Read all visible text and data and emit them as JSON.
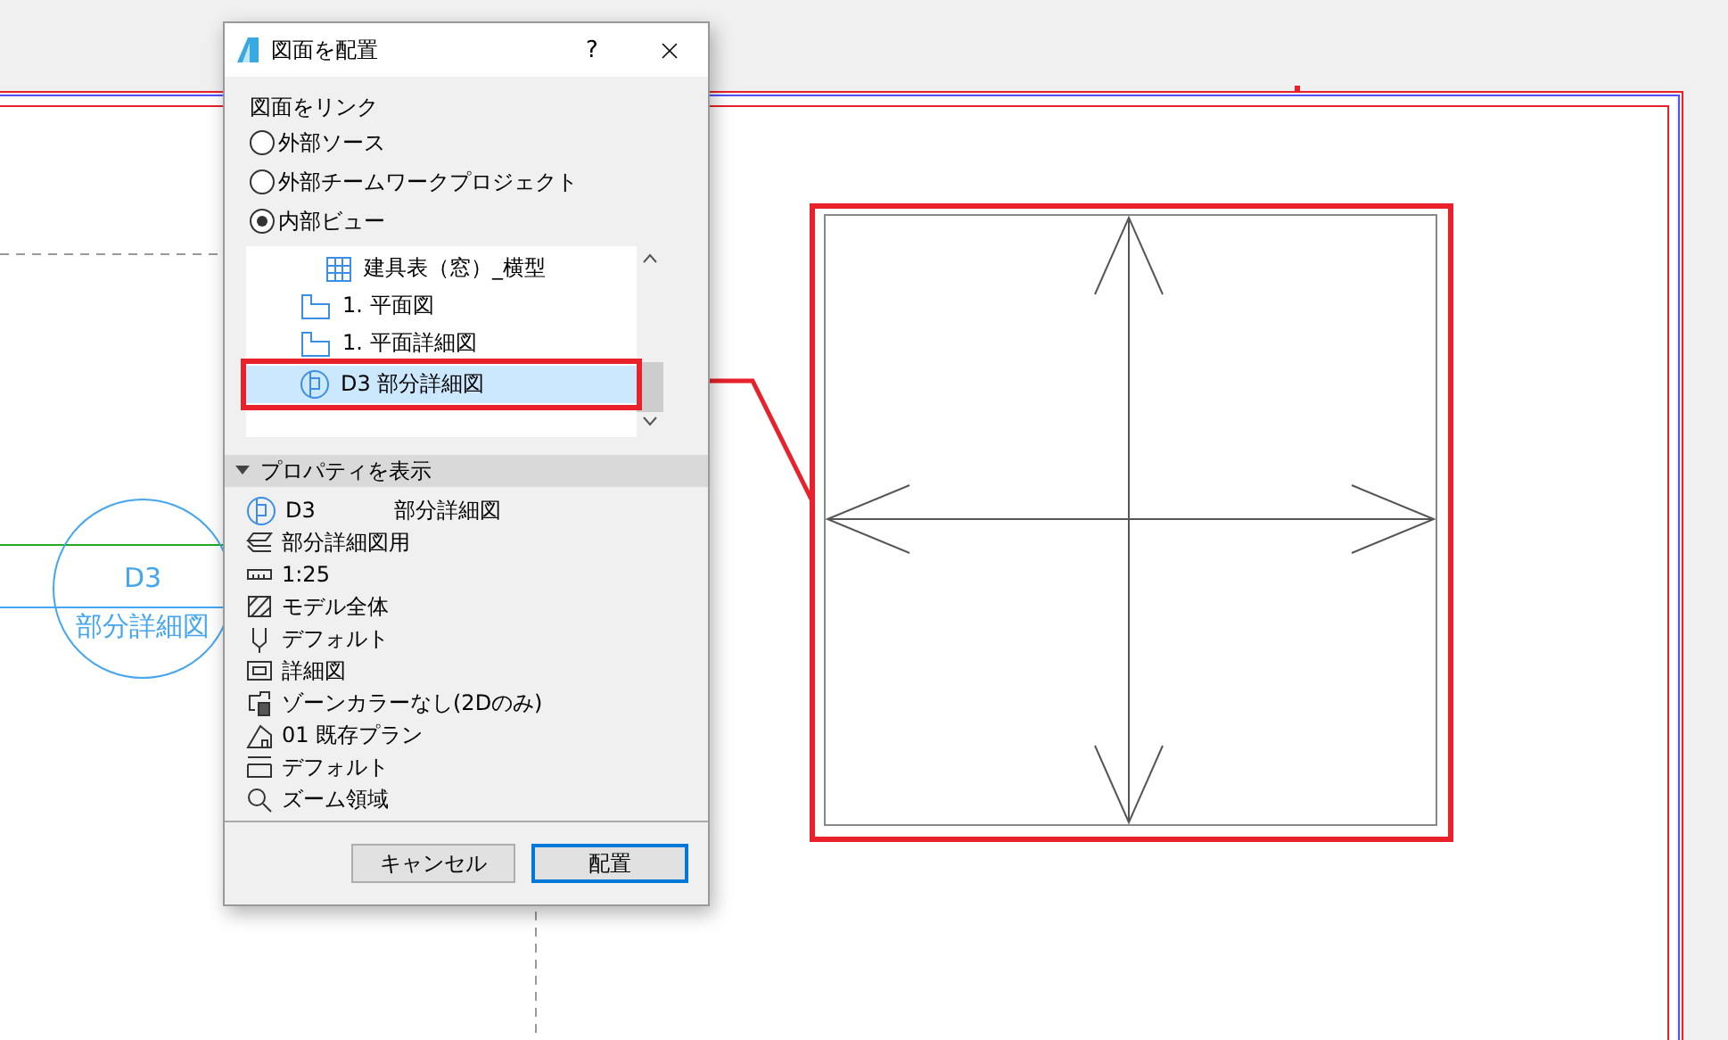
{
  "dialog": {
    "title": "図面を配置",
    "help": "?",
    "link_label": "図面をリンク",
    "radios": [
      {
        "label": "外部ソース",
        "selected": false
      },
      {
        "label": "外部チームワークプロジェクト",
        "selected": false
      },
      {
        "label": "内部ビュー",
        "selected": true
      }
    ],
    "tree": [
      {
        "kind": "schedule",
        "label": "建具表（窓）_横型",
        "selected": false
      },
      {
        "kind": "plan",
        "label": "1. 平面図",
        "selected": false
      },
      {
        "kind": "plan",
        "label": "1. 平面詳細図",
        "selected": false
      },
      {
        "kind": "detail",
        "label": "D3 部分詳細図",
        "selected": true
      }
    ],
    "properties": {
      "title": "プロパティを表示",
      "expanded": true,
      "rows": [
        {
          "kind": "detail",
          "texts": [
            "D3",
            "部分詳細図"
          ]
        },
        {
          "kind": "layers",
          "texts": [
            "部分詳細図用"
          ]
        },
        {
          "kind": "scale",
          "texts": [
            "1:25"
          ]
        },
        {
          "kind": "model",
          "texts": [
            "モデル全体"
          ]
        },
        {
          "kind": "pen",
          "texts": [
            "デフォルト"
          ]
        },
        {
          "kind": "frame",
          "texts": [
            "詳細図"
          ]
        },
        {
          "kind": "zone",
          "texts": [
            "ゾーンカラーなし(2Dのみ)"
          ]
        },
        {
          "kind": "renovation",
          "texts": [
            "01 既存プラン"
          ]
        },
        {
          "kind": "dimension",
          "texts": [
            "デフォルト"
          ]
        },
        {
          "kind": "zoom",
          "texts": [
            "ズーム領域"
          ]
        }
      ]
    },
    "buttons": [
      {
        "label": "キャンセル",
        "selected": false
      },
      {
        "label": "配置",
        "selected": true
      }
    ]
  },
  "marker": {
    "id": "D3",
    "name": "部分詳細図"
  }
}
